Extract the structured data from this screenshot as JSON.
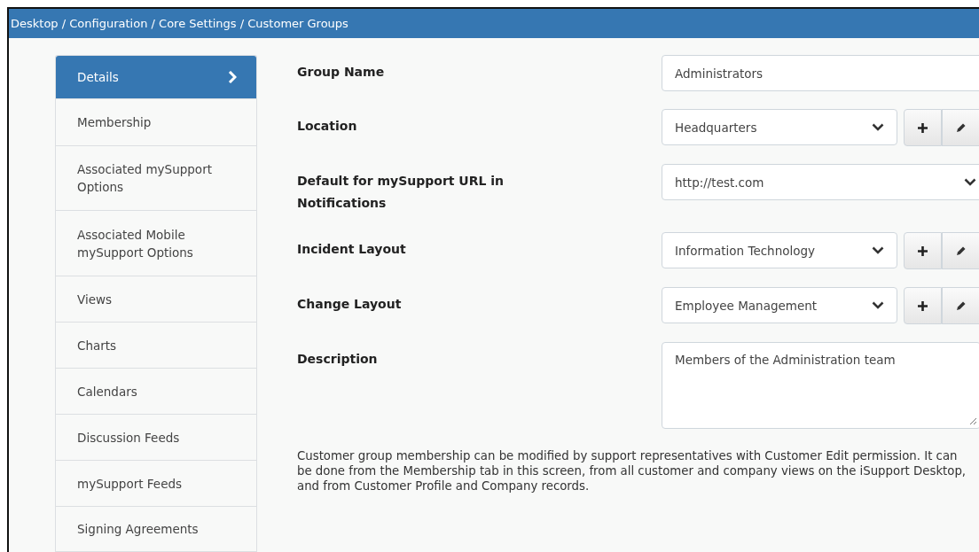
{
  "breadcrumb": "Desktop / Configuration / Core Settings / Customer Groups",
  "sidebar": {
    "items": [
      {
        "label": "Details",
        "selected": true
      },
      {
        "label": "Membership",
        "selected": false
      },
      {
        "label": "Associated mySupport Options",
        "selected": false
      },
      {
        "label": "Associated Mobile mySupport Options",
        "selected": false
      },
      {
        "label": "Views",
        "selected": false
      },
      {
        "label": "Charts",
        "selected": false
      },
      {
        "label": "Calendars",
        "selected": false
      },
      {
        "label": "Discussion Feeds",
        "selected": false
      },
      {
        "label": "mySupport Feeds",
        "selected": false
      },
      {
        "label": "Signing Agreements",
        "selected": false
      }
    ]
  },
  "form": {
    "fields": [
      {
        "label": "Group Name",
        "kind": "text",
        "value": "Administrators"
      },
      {
        "label": "Location",
        "kind": "select_actions",
        "value": "Headquarters"
      },
      {
        "label": "Default for mySupport URL in Notifications",
        "kind": "select",
        "value": "http://test.com"
      },
      {
        "label": "Incident Layout",
        "kind": "select_actions",
        "value": "Information Technology"
      },
      {
        "label": "Change Layout",
        "kind": "select_actions",
        "value": "Employee Management"
      },
      {
        "label": "Description",
        "kind": "textarea",
        "value": "Members of the Administration team"
      }
    ],
    "note": "Customer group membership can be modified by support representatives with Customer Edit permission. It can be done from the Membership tab in this screen, from all customer and company views on the iSupport Desktop, and from Customer Profile and Company records."
  }
}
